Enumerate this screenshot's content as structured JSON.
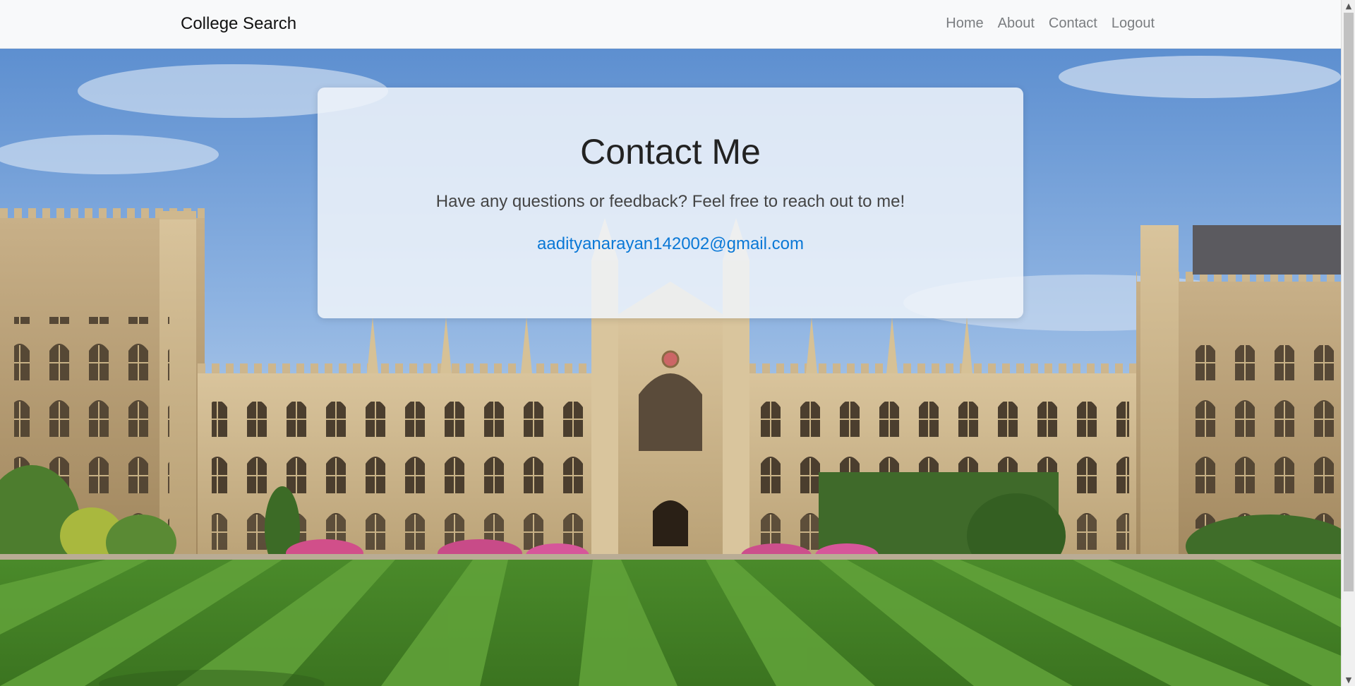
{
  "navbar": {
    "brand": "College Search",
    "links": [
      {
        "label": "Home"
      },
      {
        "label": "About"
      },
      {
        "label": "Contact"
      },
      {
        "label": "Logout"
      }
    ]
  },
  "contact": {
    "title": "Contact Me",
    "text": "Have any questions or feedback? Feel free to reach out to me!",
    "email": "aadityanarayan142002@gmail.com"
  },
  "colors": {
    "link": "#0a78d6",
    "navbar_bg": "#f8f9fa",
    "sky": "#6a9bd8",
    "lawn": "#4f8a2b"
  },
  "scrollbar": {
    "up_icon": "scroll-up-arrow-icon",
    "down_icon": "scroll-down-arrow-icon"
  }
}
